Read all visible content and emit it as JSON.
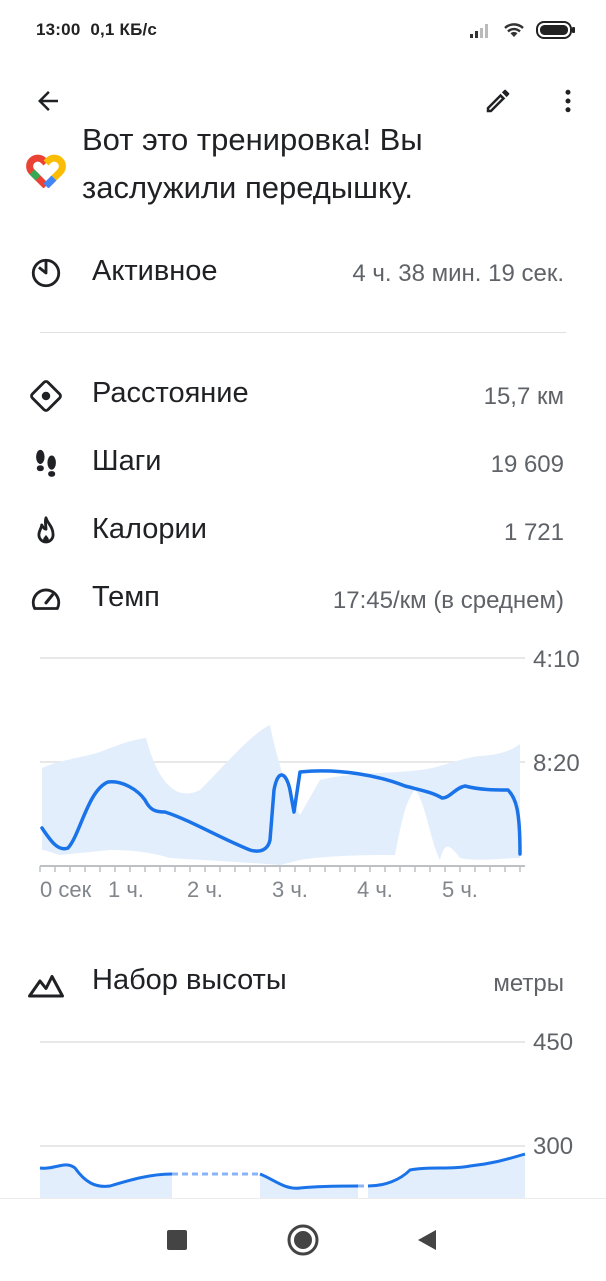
{
  "status_bar": {
    "time": "13:00",
    "speed": "0,1 КБ/с",
    "icons": [
      "signal-icon",
      "wifi-icon",
      "battery-icon"
    ]
  },
  "toolbar": {
    "back_icon": "arrow-left-icon",
    "edit_icon": "pencil-icon",
    "more_icon": "more-vert-icon"
  },
  "headline": {
    "line1": "Вот это тренировка! Вы",
    "line2": "заслужили передышку.",
    "logo": "google-fit-heart-logo"
  },
  "active": {
    "label": "Активное",
    "value": "4 ч. 38 мин. 19 сек.",
    "icon": "timer-icon"
  },
  "stats": [
    {
      "label": "Расстояние",
      "value": "15,7 км",
      "icon": "diamond-location-icon"
    },
    {
      "label": "Шаги",
      "value": "19 609",
      "icon": "footprints-icon"
    },
    {
      "label": "Калории",
      "value": "1 721",
      "icon": "fire-icon"
    },
    {
      "label": "Темп",
      "value": "17:45/км (в среднем)",
      "icon": "speedometer-icon"
    }
  ],
  "pace_chart": {
    "y_labels": [
      "4:10",
      "8:20"
    ],
    "x_labels": [
      "0 сек",
      "1 ч.",
      "2 ч.",
      "3 ч.",
      "4 ч.",
      "5 ч."
    ]
  },
  "elevation": {
    "label": "Набор высоты",
    "unit": "метры",
    "icon": "mountain-icon",
    "y_labels": [
      "450",
      "300"
    ]
  },
  "nav": {
    "recents_icon": "square-icon",
    "home_icon": "circle-icon",
    "back_icon": "triangle-back-icon"
  },
  "colors": {
    "accent": "#1a73e8",
    "band": "#e3eefc",
    "text_primary": "#202124",
    "text_secondary": "#5f6368"
  },
  "chart_data": [
    {
      "type": "line",
      "xlabel": "",
      "ylabel": "",
      "x_ticks": [
        "0 сек",
        "1 ч.",
        "2 ч.",
        "3 ч.",
        "4 ч.",
        "5 ч."
      ],
      "y_ticks": [
        "4:10",
        "8:20"
      ],
      "y_inverted": true,
      "series": [
        {
          "x": [
            0,
            0.2,
            0.45,
            0.65,
            0.8,
            0.95,
            1.1,
            1.3,
            1.6,
            2.0,
            2.4,
            2.65,
            2.75,
            2.82,
            2.9,
            2.95,
            3.0,
            3.4,
            3.8,
            4.2,
            4.6,
            4.9,
            5.2,
            5.5,
            5.62,
            5.68
          ],
          "y": [
            9.2,
            9.9,
            8.5,
            7.5,
            7.7,
            8.0,
            9.3,
            9.5,
            10.2,
            11.2,
            11.5,
            10.8,
            7.4,
            9.0,
            7.3,
            7.1,
            7.1,
            7.3,
            7.6,
            7.9,
            8.5,
            8.0,
            8.0,
            8.0,
            9.0,
            11.6
          ]
        }
      ]
    },
    {
      "type": "line",
      "xlabel": "",
      "ylabel": "",
      "y_ticks": [
        "450",
        "300"
      ],
      "series": [
        {
          "x": [
            0,
            0.2,
            0.4,
            0.6,
            0.8,
            1.0,
            1.2,
            1.5,
            1.55,
            2.5,
            2.55,
            2.8,
            3.0,
            3.5,
            3.9,
            4.2,
            4.5,
            4.8,
            5.1,
            5.4,
            5.6,
            5.68
          ],
          "y": [
            281,
            279,
            282,
            269,
            265,
            274,
            276,
            276,
            276,
            276,
            276,
            263,
            266,
            266,
            266,
            282,
            281,
            284,
            287,
            289,
            294,
            298
          ]
        }
      ]
    }
  ]
}
